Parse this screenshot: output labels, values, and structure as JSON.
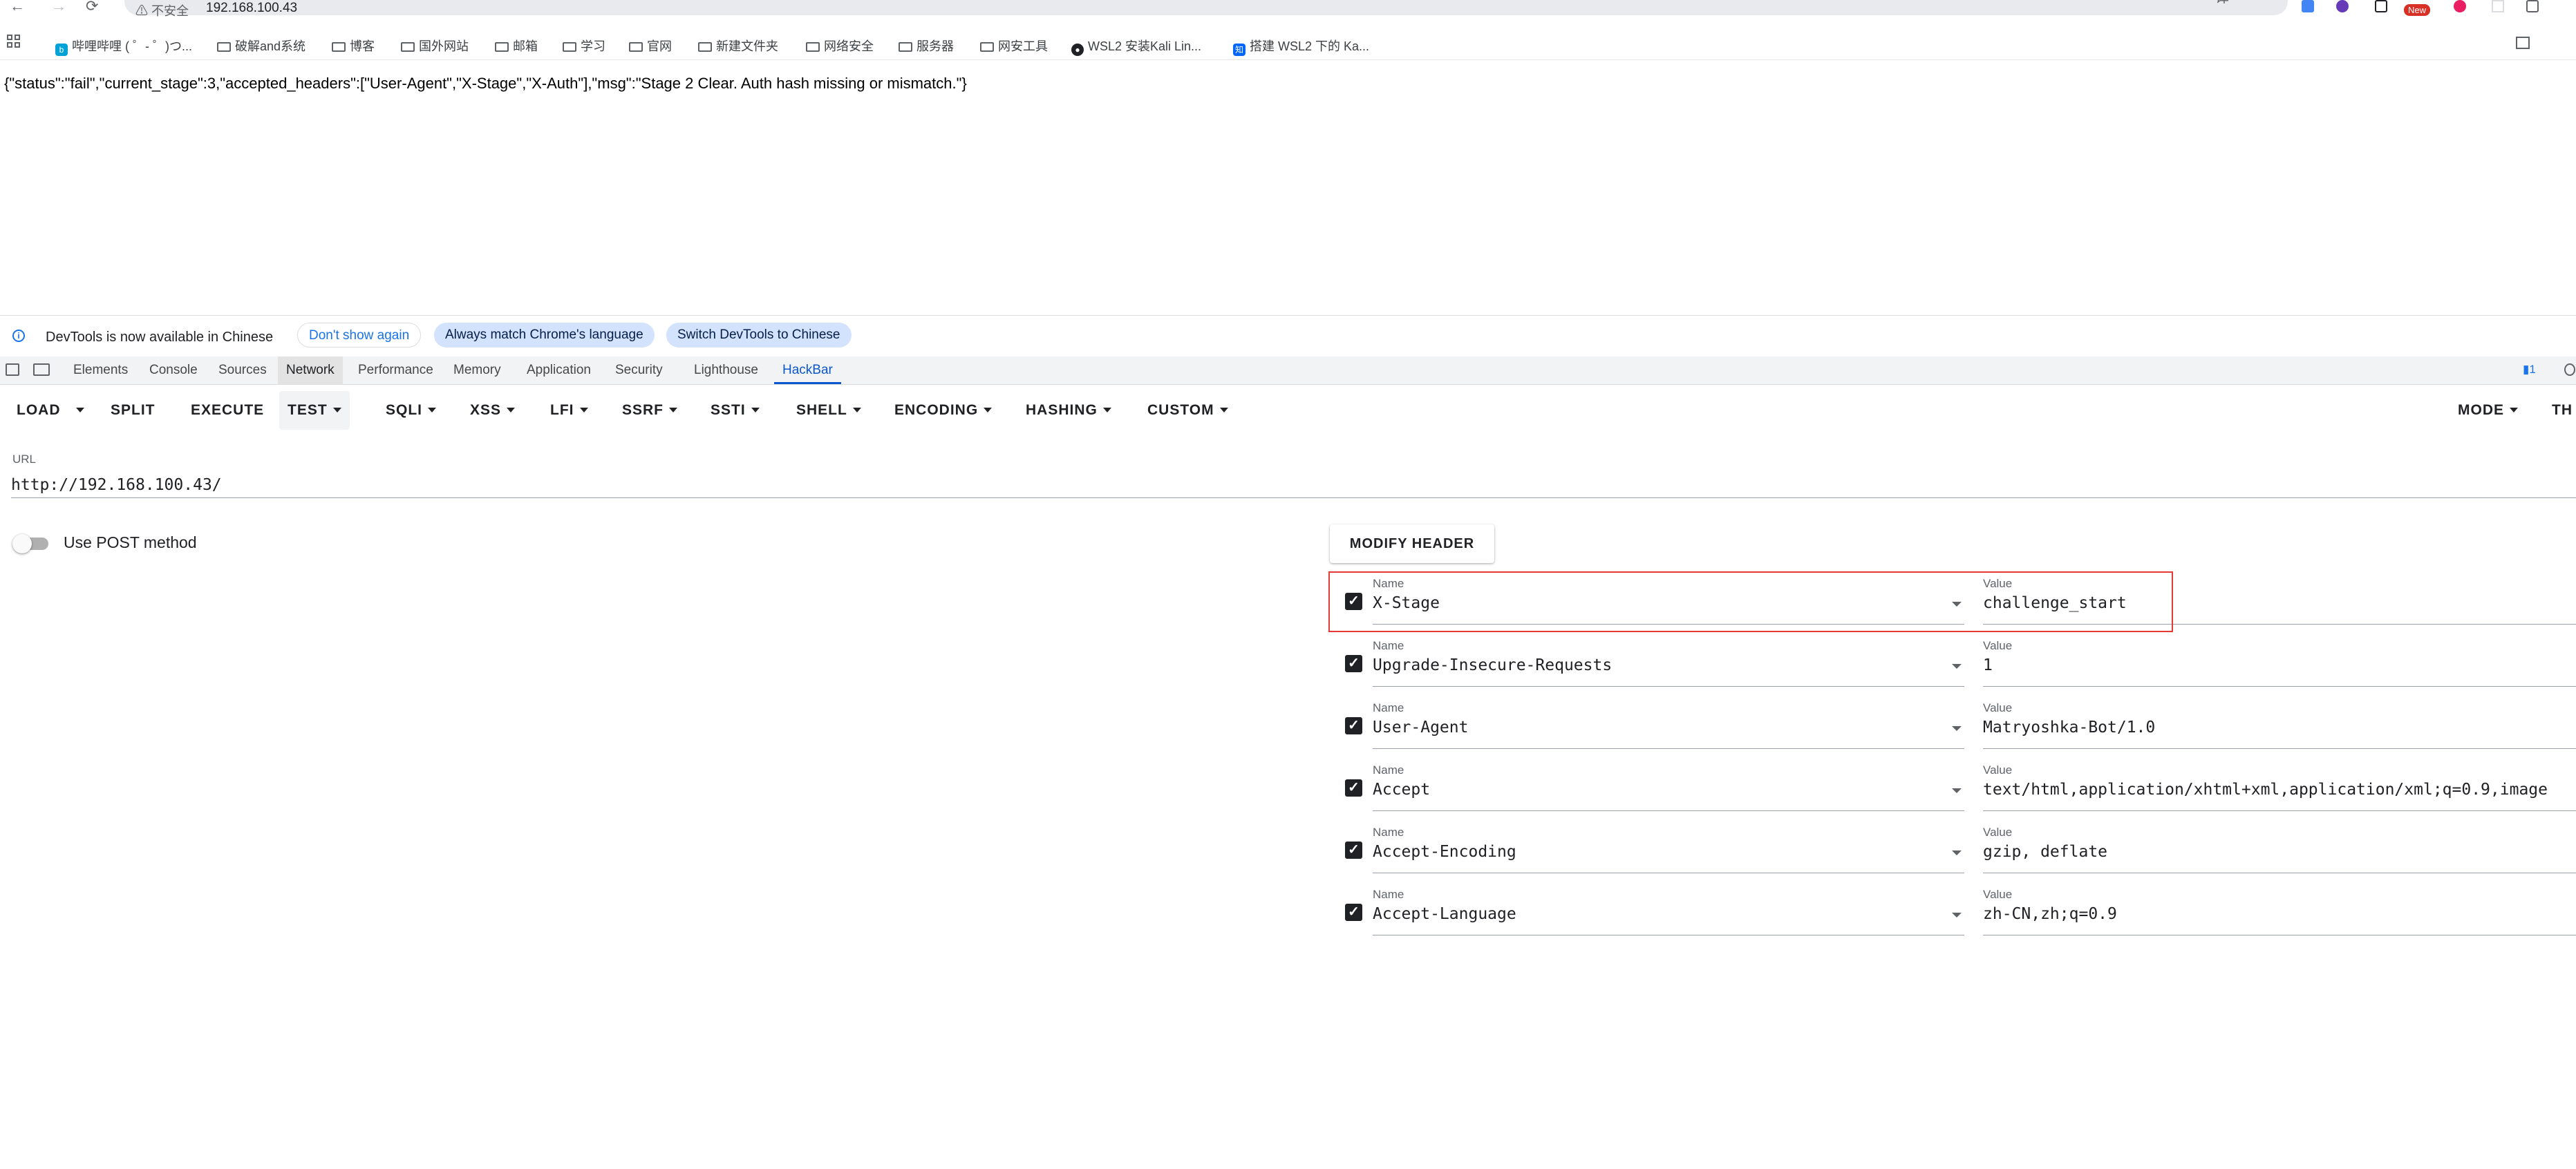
{
  "browser": {
    "nav": {
      "back": "←",
      "forward": "→",
      "reload": "⟳"
    },
    "insecure_label": "⚠ 不安全",
    "address": "192.168.100.43",
    "translate": "译",
    "star": "☆",
    "extension_badge": "New"
  },
  "bookmarks": [
    "哔哩哔哩 ( ゜- ゜)つ...",
    "破解and系统",
    "博客",
    "国外网站",
    "邮箱",
    "学习",
    "官网",
    "新建文件夹",
    "网络安全",
    "服务器",
    "网安工具",
    "WSL2 安装Kali Lin...",
    "搭建 WSL2 下的 Ka..."
  ],
  "page": {
    "json_response": "{\"status\":\"fail\",\"current_stage\":3,\"accepted_headers\":[\"User-Agent\",\"X-Stage\",\"X-Auth\"],\"msg\":\"Stage 2 Clear. Auth hash missing or mismatch.\"}"
  },
  "devtools": {
    "infobar": {
      "message": "DevTools is now available in Chinese",
      "dont_show": "Don't show again",
      "always_match": "Always match Chrome's language",
      "switch": "Switch DevTools to Chinese"
    },
    "tabs": [
      "Elements",
      "Console",
      "Sources",
      "Network",
      "Performance",
      "Memory",
      "Application",
      "Security",
      "Lighthouse",
      "HackBar"
    ],
    "issues_count": "1"
  },
  "hackbar": {
    "toolbar": [
      "LOAD",
      "SPLIT",
      "EXECUTE",
      "TEST",
      "SQLI",
      "XSS",
      "LFI",
      "SSRF",
      "SSTI",
      "SHELL",
      "ENCODING",
      "HASHING",
      "CUSTOM"
    ],
    "mode": "MODE",
    "theme": "TH",
    "url_label": "URL",
    "url_value": "http://192.168.100.43/",
    "post_label": "Use POST method",
    "modify_header": "MODIFY HEADER",
    "name_label": "Name",
    "value_label": "Value",
    "headers": [
      {
        "name": "X-Stage",
        "value": "challenge_start",
        "checked": true
      },
      {
        "name": "Upgrade-Insecure-Requests",
        "value": "1",
        "checked": true
      },
      {
        "name": "User-Agent",
        "value": "Matryoshka-Bot/1.0",
        "checked": true
      },
      {
        "name": "Accept",
        "value": "text/html,application/xhtml+xml,application/xml;q=0.9,image",
        "checked": true
      },
      {
        "name": "Accept-Encoding",
        "value": "gzip, deflate",
        "checked": true
      },
      {
        "name": "Accept-Language",
        "value": "zh-CN,zh;q=0.9",
        "checked": true
      }
    ],
    "highlight_color": "#e53935"
  }
}
